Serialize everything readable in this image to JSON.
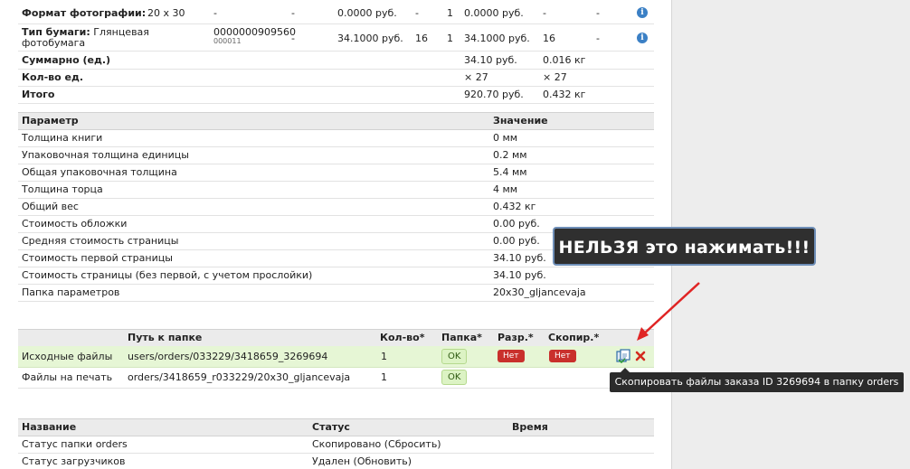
{
  "price_rows": [
    {
      "label": "Формат фотографии:",
      "desc": "20 x 30",
      "code": "-",
      "code2": "",
      "c3": "-",
      "price": "0.0000 руб.",
      "c5": "-",
      "qty": "1",
      "total": "0.0000 руб.",
      "c8": "-",
      "c9": "-"
    },
    {
      "label": "Тип бумаги:",
      "desc_line1": "Глянцевая",
      "desc_line2": "фотобумага",
      "code": "0000000909560",
      "code2": "000011",
      "c3": "-",
      "price": "34.1000 руб.",
      "c5": "16",
      "qty": "1",
      "total": "34.1000 руб.",
      "c8": "16",
      "c9": "-"
    }
  ],
  "summary": [
    {
      "label": "Суммарно (ед.)",
      "v1": "34.10 руб.",
      "v2": "0.016 кг"
    },
    {
      "label": "Кол-во ед.",
      "v1": "× 27",
      "v2": "× 27"
    },
    {
      "label": "Итого",
      "v1": "920.70 руб.",
      "v2": "0.432 кг"
    }
  ],
  "params": {
    "header": {
      "param": "Параметр",
      "value": "Значение"
    },
    "rows": [
      {
        "name": "Толщина книги",
        "value": "0 мм"
      },
      {
        "name": "Упаковочная толщина единицы",
        "value": "0.2 мм"
      },
      {
        "name": "Общая упаковочная толщина",
        "value": "5.4 мм"
      },
      {
        "name": "Толщина торца",
        "value": "4 мм"
      },
      {
        "name": "Общий вес",
        "value": "0.432 кг"
      },
      {
        "name": "Стоимость обложки",
        "value": "0.00 руб."
      },
      {
        "name": "Средняя стоимость страницы",
        "value": "0.00 руб."
      },
      {
        "name": "Стоимость первой страницы",
        "value": "34.10 руб."
      },
      {
        "name": "Стоимость страницы (без первой, с учетом прослойки)",
        "value": "34.10 руб."
      },
      {
        "name": "Папка параметров",
        "value": "20x30_gljancevaja"
      }
    ]
  },
  "folders": {
    "header": {
      "path": "Путь к папке",
      "qty": "Кол-во*",
      "folder": "Папка*",
      "perm": "Разр.*",
      "copied": "Скопир.*"
    },
    "rows": [
      {
        "name": "Исходные файлы",
        "path": "users/orders/033229/3418659_3269694",
        "qty": "1",
        "folder": "OK",
        "perm": "Нет",
        "copied": "Нет"
      },
      {
        "name": "Файлы на печать",
        "path": "orders/3418659_r033229/20x30_gljancevaja",
        "qty": "1",
        "folder": "OK"
      }
    ]
  },
  "status": {
    "header": {
      "name": "Название",
      "status": "Статус",
      "time": "Время"
    },
    "rows": [
      {
        "name": "Статус папки orders",
        "status": "Скопировано (Сбросить)"
      },
      {
        "name": "Статус загрузчиков",
        "status": "Удален (Обновить)"
      }
    ]
  },
  "callout_text": "НЕЛЬЗЯ это нажимать!!!",
  "tooltip_text": "Скопировать файлы заказа ID 3269694 в папку orders",
  "colors": {
    "highlight_row": "#e6f6d5",
    "arrow": "#e02424",
    "badge_no": "#c9302c",
    "badge_ok": "#dcf3c4"
  },
  "icons": {
    "info": "info-icon",
    "copy": "copy-files-icon",
    "delete": "delete-icon"
  }
}
